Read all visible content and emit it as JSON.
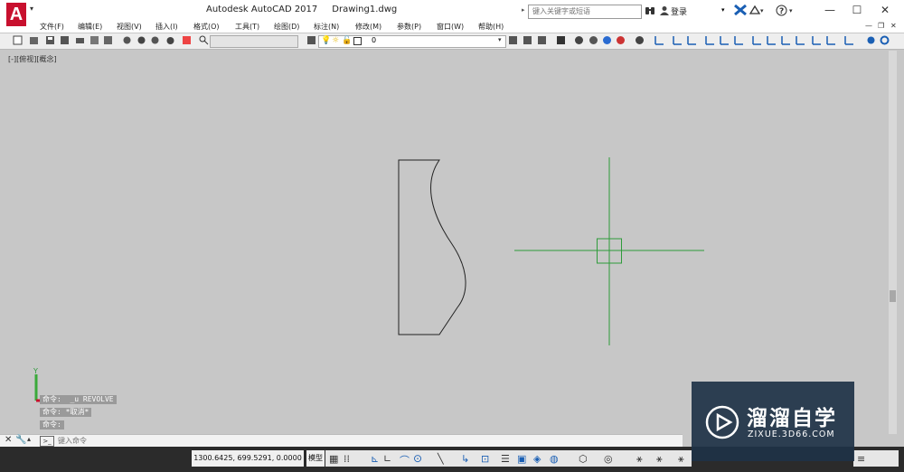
{
  "app": {
    "logo_letter": "A",
    "title": "Autodesk AutoCAD 2017",
    "document": "Drawing1.dwg"
  },
  "search": {
    "placeholder": "键入关键字或短语"
  },
  "account": {
    "login_label": "登录"
  },
  "menu": {
    "items": [
      "文件(F)",
      "编辑(E)",
      "视图(V)",
      "插入(I)",
      "格式(O)",
      "工具(T)",
      "绘图(D)",
      "标注(N)",
      "修改(M)",
      "参数(P)",
      "窗口(W)",
      "帮助(H)"
    ]
  },
  "toolbar": {
    "layer_value": "0"
  },
  "viewport": {
    "label": "[-][俯视][概念]"
  },
  "command": {
    "history": [
      "命令:  _u REVOLVE",
      "命令: *取消*",
      "命令:"
    ],
    "input_placeholder": "键入命令"
  },
  "status": {
    "coordinates": "1300.6425, 699.5291, 0.0000",
    "model_label": "模型"
  },
  "watermark": {
    "brand": "溜溜自学",
    "url": "ZIXUE.3D66.COM"
  },
  "colors": {
    "accent": "#c8102e",
    "crosshair": "#2e9b3a",
    "background": "#c7c7c7",
    "statusbar": "#2b2b2b"
  }
}
